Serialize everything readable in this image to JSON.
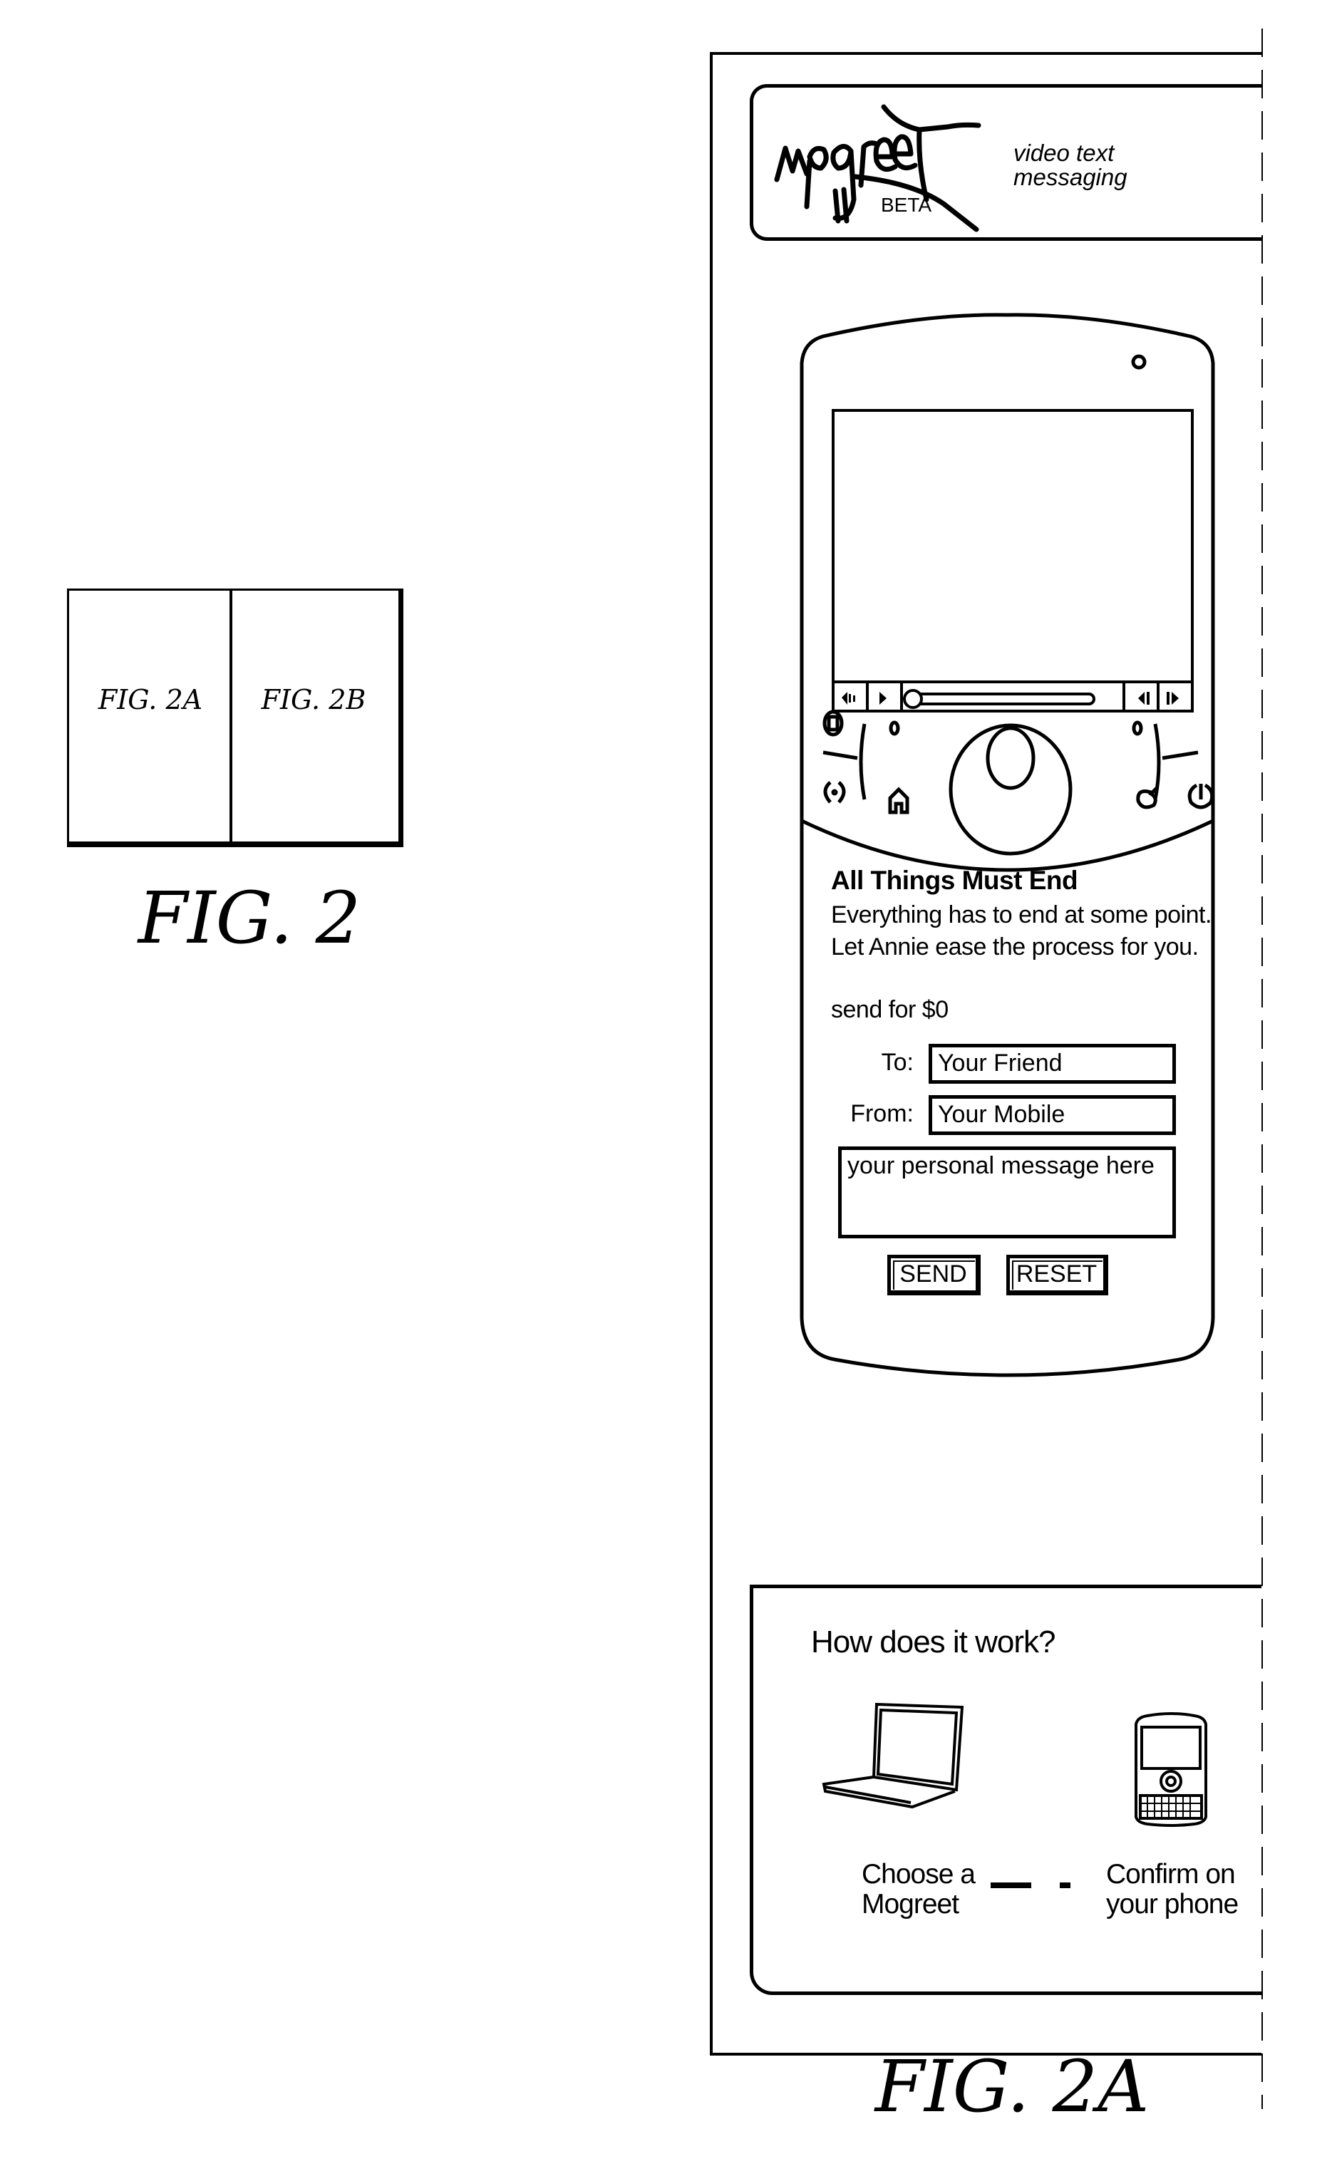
{
  "overview": {
    "cells": [
      "FIG. 2A",
      "FIG. 2B"
    ],
    "caption": "FIG. 2"
  },
  "figure_label": "FIG. 2A",
  "header": {
    "logo_text": "mogreet",
    "badge": "BETA",
    "tagline_line1": "video text",
    "tagline_line2": "messaging"
  },
  "player": {
    "controls": [
      {
        "icon": "volume-icon"
      },
      {
        "icon": "play-icon"
      },
      {
        "icon": "seek-slider"
      },
      {
        "icon": "skip-back-icon"
      },
      {
        "icon": "skip-forward-icon"
      }
    ],
    "progress": 0
  },
  "phone_keys": [
    "app-switch-icon",
    "camera-icon",
    "home-icon",
    "back-icon",
    "power-icon"
  ],
  "card": {
    "title": "All Things Must End",
    "description": "Everything has to end at some point. Let Annie ease the process for you.",
    "price": "send for $0"
  },
  "form": {
    "to_label": "To:",
    "to_value": "Your Friend",
    "from_label": "From:",
    "from_value": "Your Mobile",
    "message_value": "your personal message here",
    "send_label": "SEND",
    "reset_label": "RESET"
  },
  "how_it_works": {
    "title": "How does it work?",
    "steps": [
      {
        "line1": "Choose a",
        "line2": "Mogreet",
        "icon": "laptop-icon"
      },
      {
        "line1": "Confirm on",
        "line2": "your phone",
        "icon": "smartphone-icon"
      }
    ]
  }
}
